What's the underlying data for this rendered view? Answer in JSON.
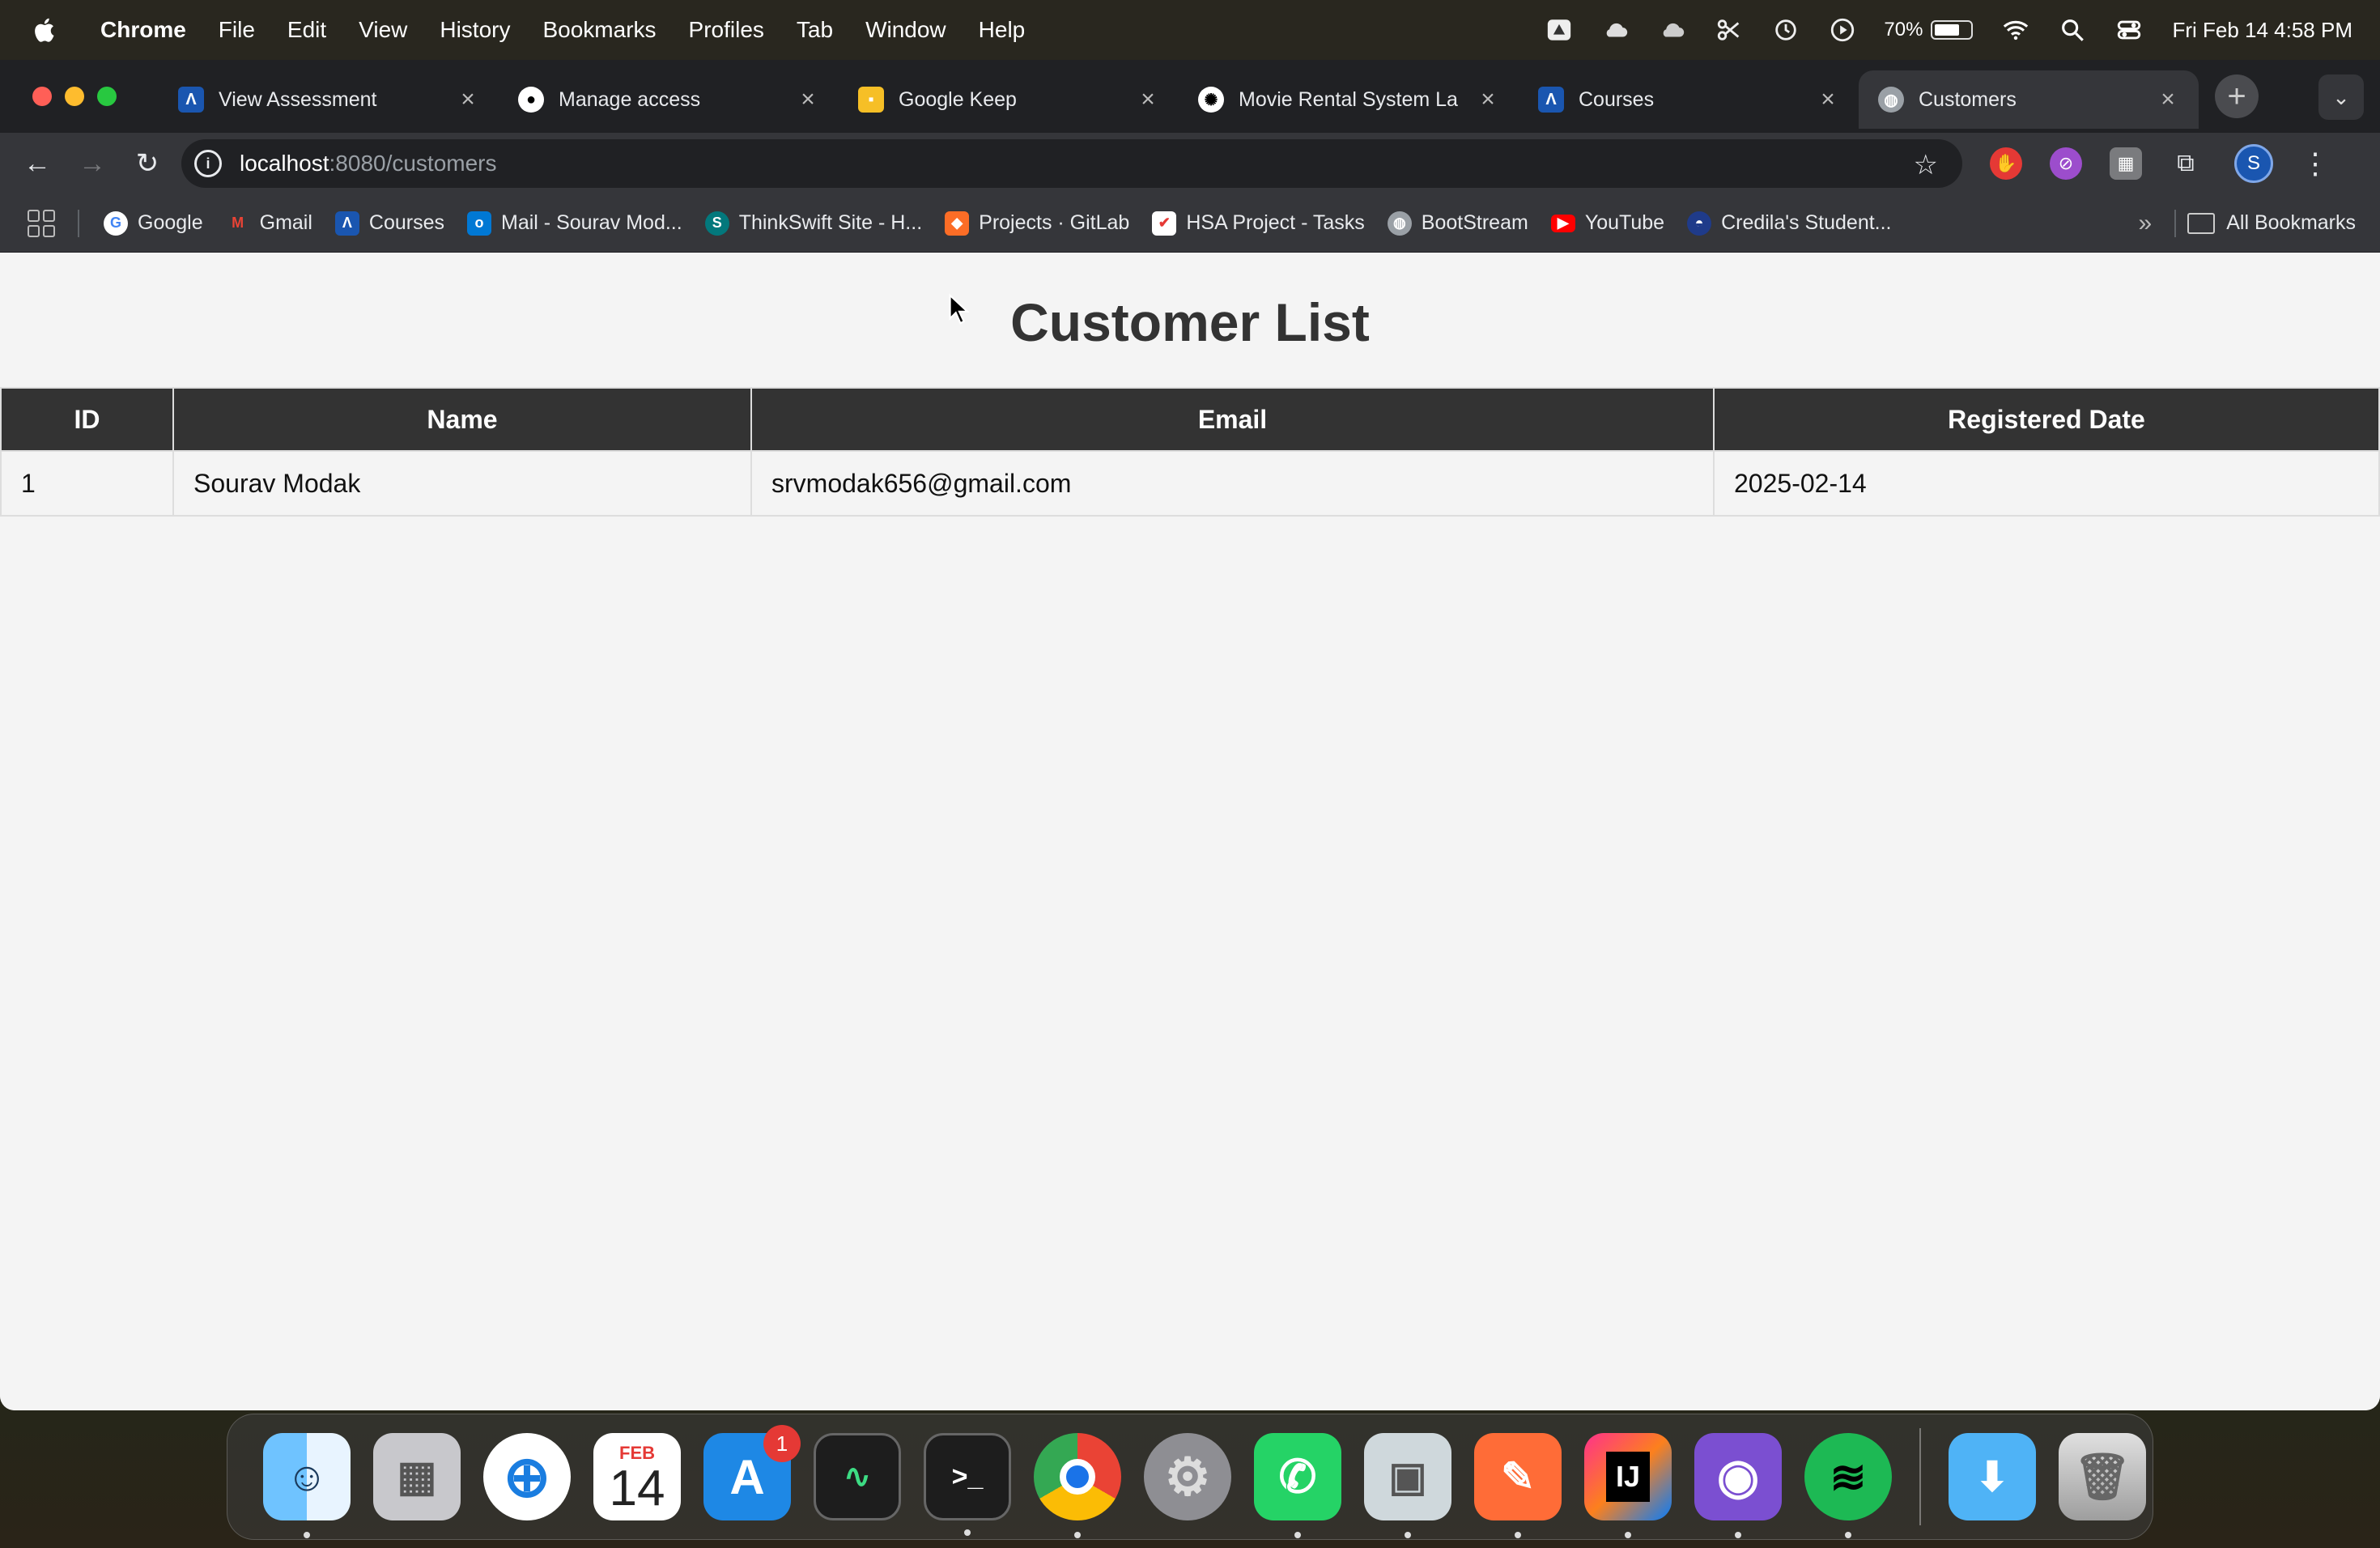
{
  "menubar": {
    "app_name": "Chrome",
    "items": [
      "File",
      "Edit",
      "View",
      "History",
      "Bookmarks",
      "Profiles",
      "Tab",
      "Window",
      "Help"
    ],
    "battery_percent": "70%",
    "clock": "Fri Feb 14  4:58 PM"
  },
  "tabs": [
    {
      "title": "View Assessment",
      "favicon_color": "#1a56b0"
    },
    {
      "title": "Manage access",
      "favicon_color": "#ffffff"
    },
    {
      "title": "Google Keep",
      "favicon_color": "#f6bf26"
    },
    {
      "title": "Movie Rental System La",
      "favicon_color": "#ffffff"
    },
    {
      "title": "Courses",
      "favicon_color": "#1a56b0"
    },
    {
      "title": "Customers",
      "favicon_color": "#9aa0a6",
      "active": true
    }
  ],
  "omnibox": {
    "host": "localhost",
    "path": ":8080/customers"
  },
  "profile_initial": "S",
  "bookmarks": [
    {
      "label": "Google",
      "color": "#ffffff"
    },
    {
      "label": "Gmail",
      "color": "#ea4335"
    },
    {
      "label": "Courses",
      "color": "#1a56b0"
    },
    {
      "label": "Mail - Sourav Mod...",
      "color": "#0078d4"
    },
    {
      "label": "ThinkSwift Site - H...",
      "color": "#03787c"
    },
    {
      "label": "Projects · GitLab",
      "color": "#fc6d26"
    },
    {
      "label": "HSA Project - Tasks",
      "color": "#ffffff"
    },
    {
      "label": "BootStream",
      "color": "#9aa0a6"
    },
    {
      "label": "YouTube",
      "color": "#ff0000"
    },
    {
      "label": "Credila's Student...",
      "color": "#1f3b8a"
    }
  ],
  "all_bookmarks_label": "All Bookmarks",
  "page": {
    "title": "Customer List",
    "columns": [
      "ID",
      "Name",
      "Email",
      "Registered Date"
    ],
    "rows": [
      {
        "id": "1",
        "name": "Sourav Modak",
        "email": "srvmodak656@gmail.com",
        "registered": "2025-02-14"
      }
    ]
  },
  "dock": {
    "apps": [
      "Finder",
      "Launchpad",
      "Safari",
      "Calendar",
      "App Store",
      "Activity Monitor",
      "Terminal",
      "Chrome",
      "System Settings",
      "WhatsApp",
      "Preview",
      "Postman",
      "IntelliJ IDEA",
      "GitHub Desktop",
      "Spotify"
    ],
    "calendar_month": "FEB",
    "calendar_day": "14",
    "app_store_badge": "1",
    "terminal_prompt": ">_",
    "intellij_label": "IJ"
  }
}
